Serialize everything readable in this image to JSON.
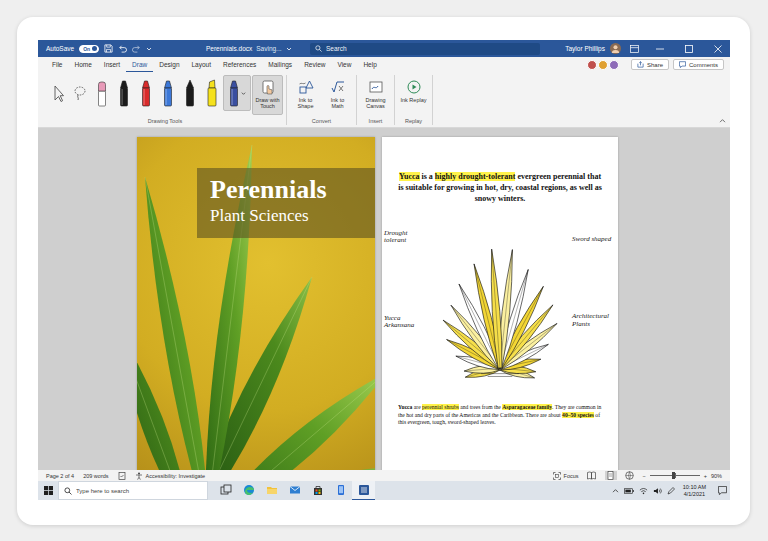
{
  "title_bar": {
    "autosave": {
      "label": "AutoSave",
      "state": "On",
      "on": true
    },
    "filename": "Perennials.docx",
    "save_status": "Saving...",
    "search": {
      "placeholder": "Search"
    },
    "user": "Taylor Phillips"
  },
  "menu": {
    "tabs": [
      {
        "label": "File",
        "selected": false
      },
      {
        "label": "Home",
        "selected": false
      },
      {
        "label": "Insert",
        "selected": false
      },
      {
        "label": "Draw",
        "selected": true
      },
      {
        "label": "Design",
        "selected": false
      },
      {
        "label": "Layout",
        "selected": false
      },
      {
        "label": "References",
        "selected": false
      },
      {
        "label": "Mailings",
        "selected": false
      },
      {
        "label": "Review",
        "selected": false
      },
      {
        "label": "View",
        "selected": false
      },
      {
        "label": "Help",
        "selected": false
      }
    ],
    "collaborators": [
      {
        "color": "#c0504d"
      },
      {
        "color": "#e0a030"
      },
      {
        "color": "#8e6bb8"
      }
    ],
    "share": "Share",
    "comments": "Comments"
  },
  "ribbon": {
    "groups": [
      {
        "label": "Drawing Tools",
        "tools": [
          {
            "kind": "select",
            "color": "#555555",
            "selected": false
          },
          {
            "kind": "lasso",
            "color": "#555555",
            "selected": false
          },
          {
            "kind": "eraser",
            "color": "#e89ab8",
            "selected": false
          },
          {
            "kind": "pen",
            "color": "#1b1b1b",
            "selected": false
          },
          {
            "kind": "pen",
            "color": "#d92b2b",
            "selected": false
          },
          {
            "kind": "pen",
            "color": "#3c78d8",
            "selected": false
          },
          {
            "kind": "pencil",
            "color": "#1b1b1b",
            "selected": false
          },
          {
            "kind": "highlighter",
            "color": "#f5e11c",
            "selected": false
          },
          {
            "kind": "pen",
            "color": "#3a4fa0",
            "selected": true
          }
        ],
        "buttons": [
          {
            "label": "Draw with Touch",
            "kind": "touch",
            "selected": true
          }
        ]
      },
      {
        "label": "Convert",
        "tools": [],
        "buttons": [
          {
            "label": "Ink to Shape",
            "kind": "shape",
            "selected": false
          },
          {
            "label": "Ink to Math",
            "kind": "math",
            "selected": false
          }
        ]
      },
      {
        "label": "Insert",
        "tools": [],
        "buttons": [
          {
            "label": "Drawing Canvas",
            "kind": "canvas",
            "selected": false
          }
        ]
      },
      {
        "label": "Replay",
        "tools": [],
        "buttons": [
          {
            "label": "Ink Replay",
            "kind": "replay",
            "selected": false
          }
        ]
      }
    ]
  },
  "document": {
    "cover": {
      "title": "Perennials",
      "subtitle": "Plant Sciences"
    },
    "page": {
      "intro": [
        {
          "text": "Yucca",
          "highlighted": true
        },
        {
          "text": " is a ",
          "highlighted": false
        },
        {
          "text": "highly drought-tolerant",
          "highlighted": true
        },
        {
          "text": " evergreen perennial that is suitable for growing in hot, dry, coastal regions, as well as snowy winters.",
          "highlighted": false
        }
      ],
      "annotations": [
        "Drought tolerant",
        "Sword shaped",
        "Yucca Arkansana",
        "Architectural Plants"
      ],
      "body": [
        {
          "text": "Yucca",
          "bold": true,
          "highlighted": false
        },
        {
          "text": " are ",
          "bold": false,
          "highlighted": false
        },
        {
          "text": "perennial shrubs",
          "bold": false,
          "highlighted": true
        },
        {
          "text": " and trees from the ",
          "bold": false,
          "highlighted": false
        },
        {
          "text": "Asparagaceae family",
          "bold": true,
          "highlighted": true
        },
        {
          "text": ". They are common in the hot and dry parts of the Americas and the Caribbean. There are about ",
          "bold": false,
          "highlighted": false
        },
        {
          "text": "40–50 species",
          "bold": true,
          "highlighted": true
        },
        {
          "text": " of this evergreen, tough, sword-shaped leaves.",
          "bold": false,
          "highlighted": false
        }
      ]
    }
  },
  "status_bar": {
    "page": "Page 2 of 4",
    "words": "209 words",
    "accessibility": "Accessibility: Investigate",
    "focus": "Focus",
    "views": [
      {
        "kind": "read",
        "selected": false
      },
      {
        "kind": "print",
        "selected": true
      },
      {
        "kind": "web",
        "selected": false
      }
    ],
    "zoom": {
      "out": "−",
      "in": "+",
      "level": 0.47,
      "reading": "90%"
    }
  },
  "taskbar": {
    "search": {
      "placeholder": "Type here to search"
    },
    "apps": [
      {
        "kind": "taskview",
        "selected": false
      },
      {
        "kind": "edge",
        "selected": false
      },
      {
        "kind": "explorer",
        "selected": false
      },
      {
        "kind": "mail",
        "selected": false
      },
      {
        "kind": "store",
        "selected": false
      },
      {
        "kind": "phone",
        "selected": false
      },
      {
        "kind": "word",
        "selected": true
      }
    ],
    "time": "10:10 AM",
    "date": "4/1/2021"
  }
}
